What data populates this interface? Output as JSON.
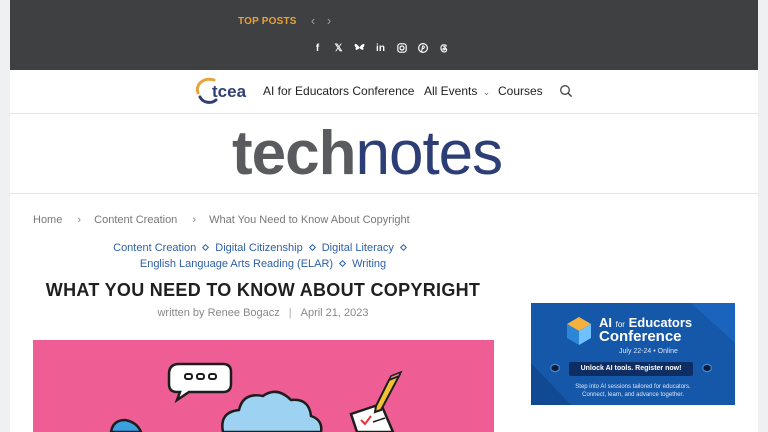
{
  "topbar": {
    "top_posts_label": "TOP POSTS",
    "prev_icon": "‹",
    "next_icon": "›",
    "social": [
      {
        "name": "facebook",
        "glyph": "f"
      },
      {
        "name": "x",
        "glyph": "𝕏"
      },
      {
        "name": "bluesky",
        "glyph": "🦋"
      },
      {
        "name": "linkedin",
        "glyph": "in"
      },
      {
        "name": "instagram",
        "glyph": "◎"
      },
      {
        "name": "pinterest",
        "glyph": "℗"
      },
      {
        "name": "threads",
        "glyph": "@"
      }
    ]
  },
  "nav": {
    "logo_text": "tcea",
    "items": [
      {
        "label": "AI for Educators Conference"
      },
      {
        "label": "All Events"
      },
      {
        "label": "Courses"
      }
    ],
    "dropdown_icon": "⌄"
  },
  "masthead": {
    "brand_part1": "tech",
    "brand_part2": "notes"
  },
  "breadcrumb": {
    "items": [
      "Home",
      "Content Creation",
      "What You Need to Know About Copyright"
    ],
    "separator": "›"
  },
  "article": {
    "categories": [
      "Content Creation",
      "Digital Citizenship",
      "Digital Literacy",
      "English Language Arts Reading (ELAR)",
      "Writing"
    ],
    "title": "WHAT YOU NEED TO KNOW ABOUT COPYRIGHT",
    "byline": "written by Renee Bogacz",
    "date": "April 21, 2023"
  },
  "ad": {
    "line1_a": "AI",
    "line1_b": "for",
    "line1_c": "Educators",
    "line2": "Conference",
    "dates": "July 22-24  •  Online",
    "cta": "Unlock AI tools. Register now!",
    "footer_line1": "Step into AI sessions tailored for educators.",
    "footer_line2": "Connect, learn, and advance together."
  },
  "colors": {
    "topbar_bg": "#3f4042",
    "accent_orange": "#e8a23b",
    "brand_navy": "#2d3e77",
    "category_blue": "#2d5fa8",
    "hero_pink": "#ee5e94",
    "ad_blue": "#1557a8"
  }
}
